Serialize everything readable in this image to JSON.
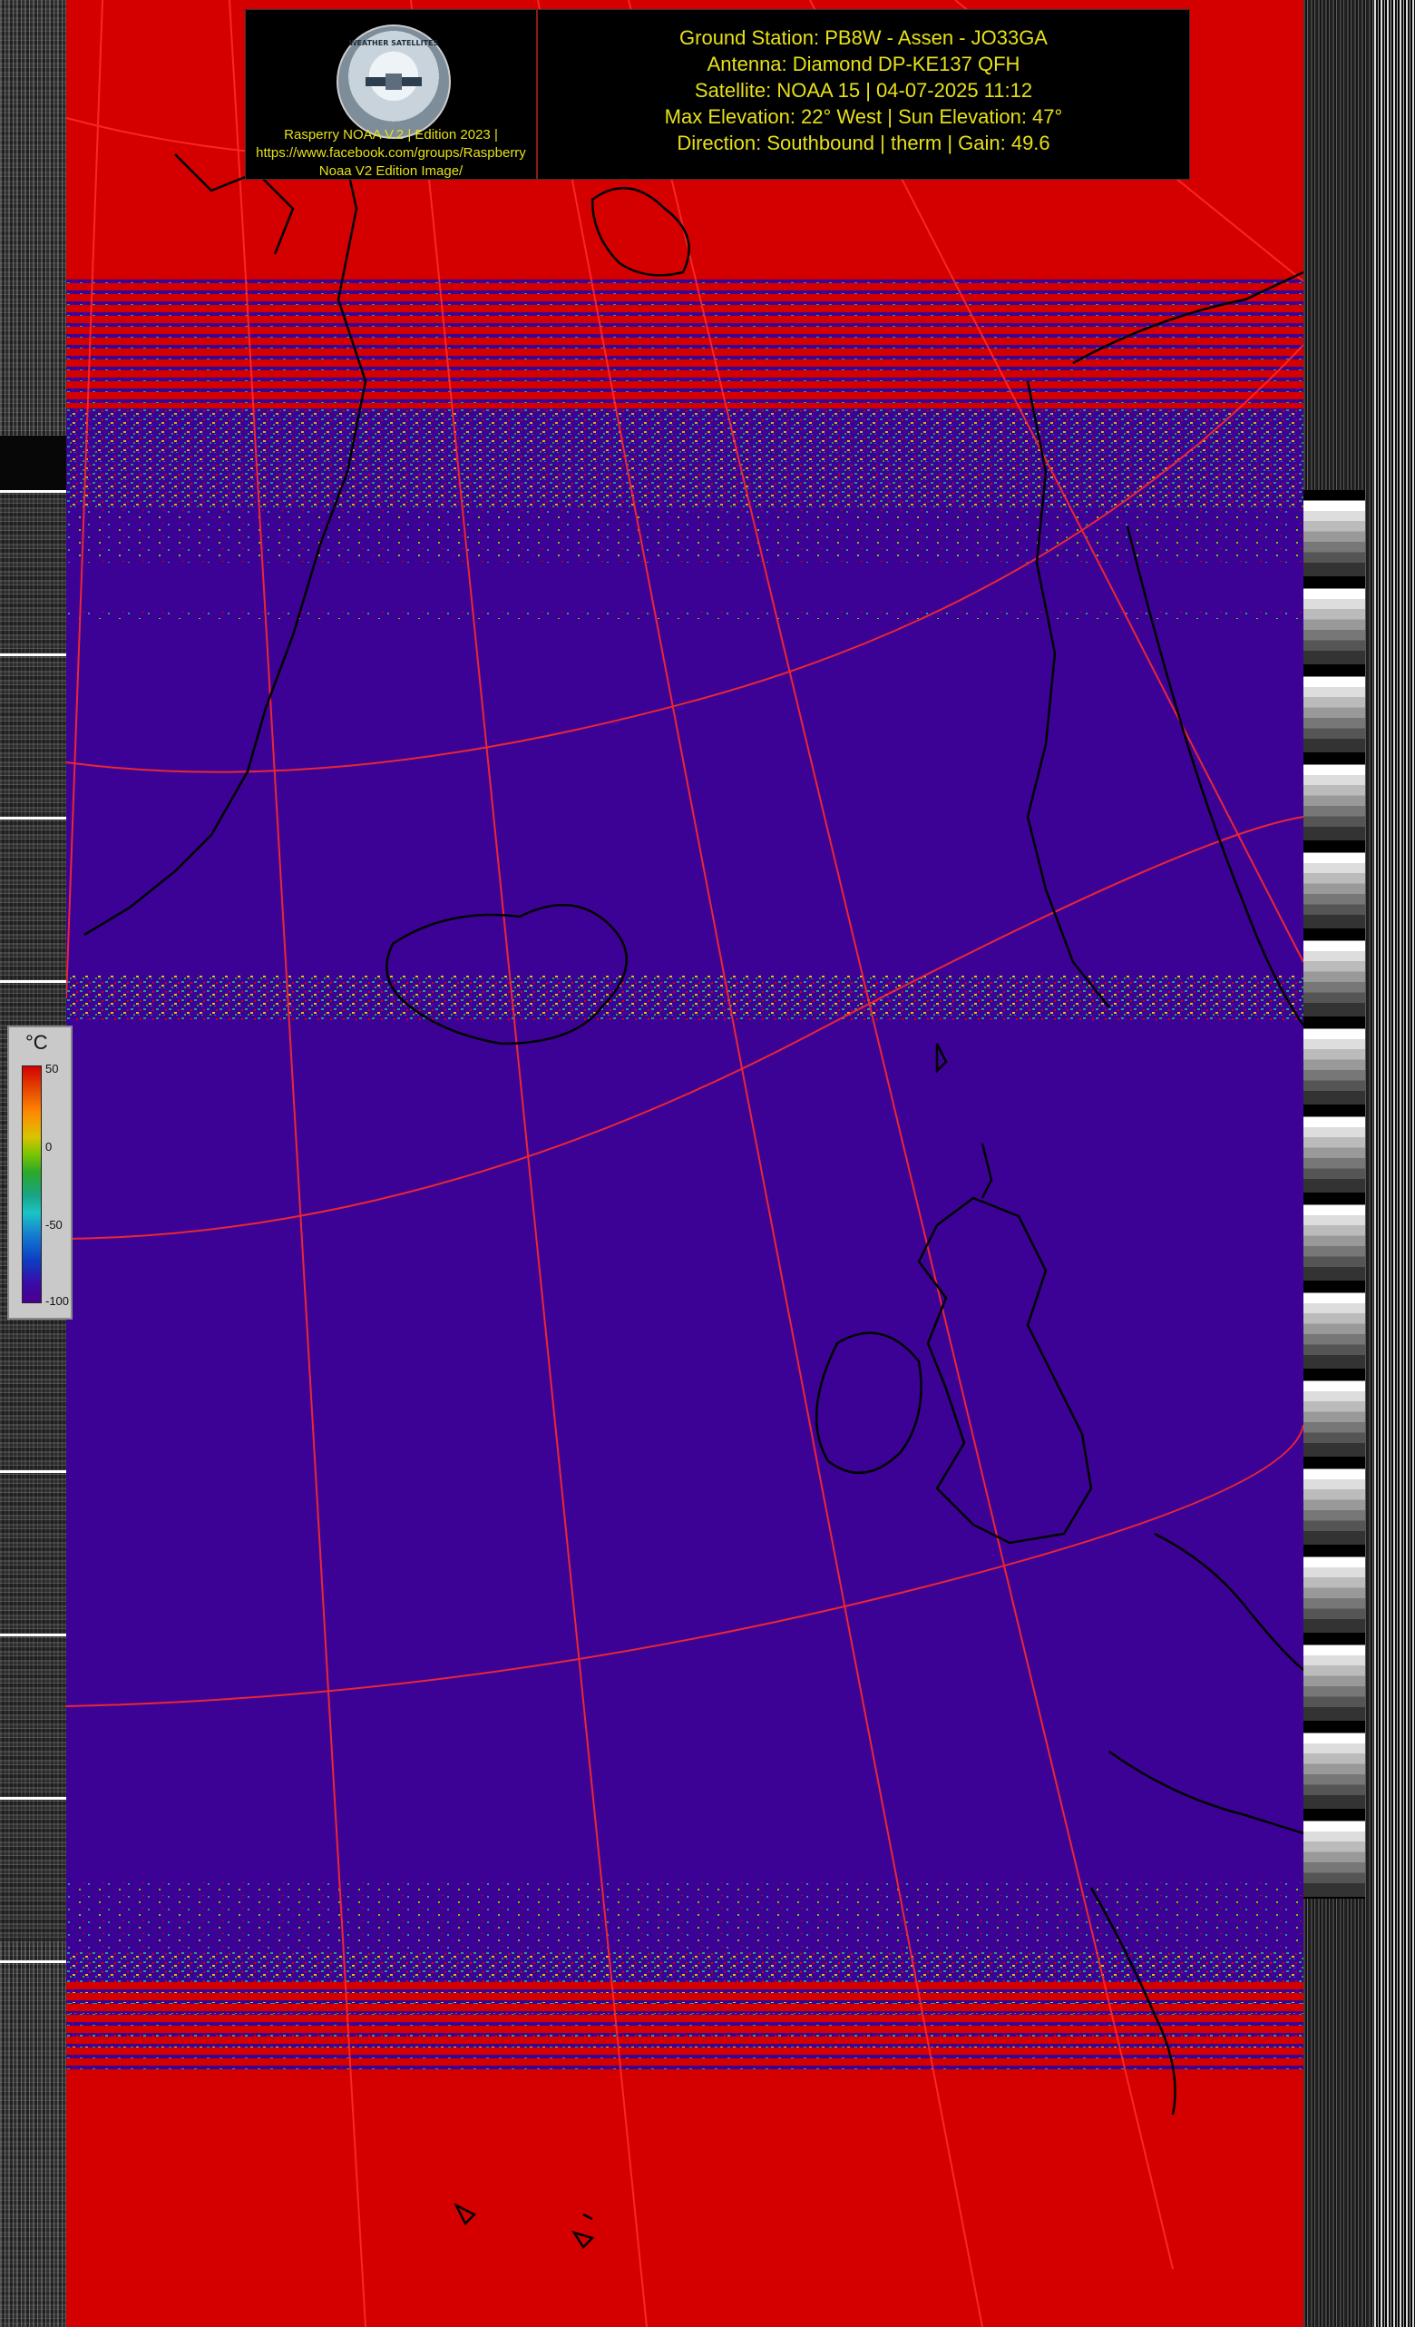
{
  "header": {
    "logo_caption_lines": [
      "Rasperry NOAA V.2 | Edition 2023 |",
      "https://www.facebook.com/groups/Raspberry",
      "Noaa V2 Edition Image/"
    ],
    "logo_ring_text": "WEATHER SATELLITES",
    "info_lines": [
      "Ground Station: PB8W - Assen - JO33GA",
      "Antenna: Diamond DP-KE137 QFH",
      "Satellite: NOAA 15 | 04-07-2025 11:12",
      "Max Elevation: 22° West | Sun Elevation: 47°",
      "Direction: Southbound | therm | Gain: 49.6"
    ]
  },
  "legend": {
    "unit": "°C",
    "ticks": [
      "50",
      "0",
      "-50",
      "-100"
    ]
  },
  "colors": {
    "cold_background": "#3c0296",
    "warm_band": "#d40000",
    "grid_line": "#ff2a2a",
    "coastline": "#000000",
    "header_text": "#e6e01a"
  }
}
